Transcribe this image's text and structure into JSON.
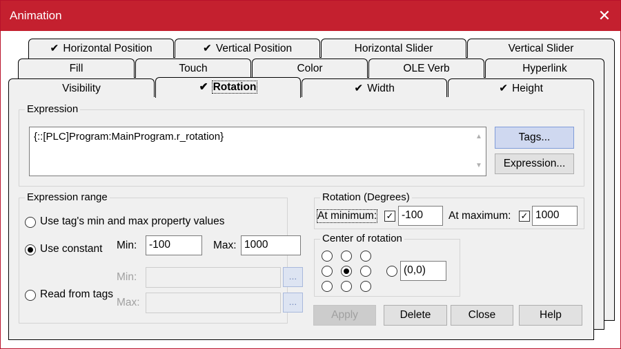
{
  "window": {
    "title": "Animation",
    "close_glyph": "✕"
  },
  "tabs": {
    "row1": [
      {
        "label": "Horizontal Position",
        "checked": true
      },
      {
        "label": "Vertical Position",
        "checked": true
      },
      {
        "label": "Horizontal Slider",
        "checked": false
      },
      {
        "label": "Vertical Slider",
        "checked": false
      }
    ],
    "row2": [
      {
        "label": "Fill",
        "checked": false
      },
      {
        "label": "Touch",
        "checked": false
      },
      {
        "label": "Color",
        "checked": false
      },
      {
        "label": "OLE Verb",
        "checked": false
      },
      {
        "label": "Hyperlink",
        "checked": false
      }
    ],
    "row3": [
      {
        "label": "Visibility",
        "checked": false
      },
      {
        "label": "Rotation",
        "checked": true,
        "active": true
      },
      {
        "label": "Width",
        "checked": true
      },
      {
        "label": "Height",
        "checked": true
      }
    ],
    "check_glyph": "✔"
  },
  "expression": {
    "group_label": "Expression",
    "value": "{::[PLC]Program:MainProgram.r_rotation}",
    "tags_button": "Tags...",
    "expression_button": "Expression..."
  },
  "expression_range": {
    "group_label": "Expression range",
    "opt_tag_minmax": "Use tag's min and max property values",
    "opt_constant": "Use constant",
    "opt_read_tags": "Read from tags",
    "min_label": "Min:",
    "max_label": "Max:",
    "min_value": "-100",
    "max_value": "1000",
    "tags_min_label": "Min:",
    "tags_max_label": "Max:",
    "browse_glyph": "..."
  },
  "rotation": {
    "group_label": "Rotation (Degrees)",
    "at_min_label": "At minimum:",
    "at_min_value": "-100",
    "at_max_label": "At maximum:",
    "at_max_value": "1000",
    "check_glyph": "✓"
  },
  "center": {
    "group_label": "Center of rotation",
    "custom_value": "(0,0)"
  },
  "buttons": {
    "apply": "Apply",
    "delete": "Delete",
    "close": "Close",
    "help": "Help"
  }
}
